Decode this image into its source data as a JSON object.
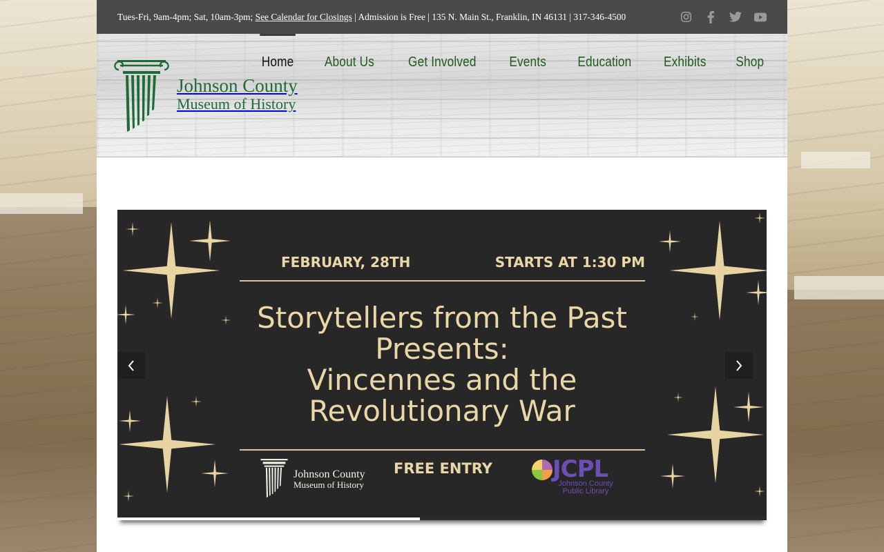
{
  "topbar": {
    "hours": "Tues-Fri, 9am-4pm; Sat, 10am-3pm;",
    "calendar_link": "See Calendar for Closings",
    "admission": "| Admission is Free  |  135 N. Main St., Franklin, IN 46131 | 317-346-4500",
    "social_icons": [
      "instagram-icon",
      "facebook-icon",
      "twitter-icon",
      "youtube-icon"
    ]
  },
  "logo": {
    "line1": "Johnson County",
    "line2": "Museum of History"
  },
  "nav": {
    "items": [
      {
        "label": "Home",
        "active": true
      },
      {
        "label": "About Us"
      },
      {
        "label": "Get Involved"
      },
      {
        "label": "Events"
      },
      {
        "label": "Education"
      },
      {
        "label": "Exhibits"
      },
      {
        "label": "Shop"
      }
    ]
  },
  "slide": {
    "date": "FEBRUARY, 28TH",
    "time": "STARTS AT 1:30 PM",
    "title_line1": "Storytellers from the Past",
    "title_line2": "Presents:",
    "title_line3": "Vincennes and the",
    "title_line4": "Revolutionary War",
    "footer_logo_line1": "Johnson County",
    "footer_logo_line2": "Museum of History",
    "entry": "FREE ENTRY",
    "partner_name": "JCPL",
    "partner_sub": "Johnson County Public Library",
    "progress": 0.466
  },
  "colors": {
    "topbar_bg": "#4a4a4a",
    "nav_text": "#1f5a1f",
    "logo_green": "#1f6b37",
    "slide_bg": "#272727",
    "slide_gold": "#ead7a8",
    "jcpl_purple": "#6a4fb4"
  }
}
